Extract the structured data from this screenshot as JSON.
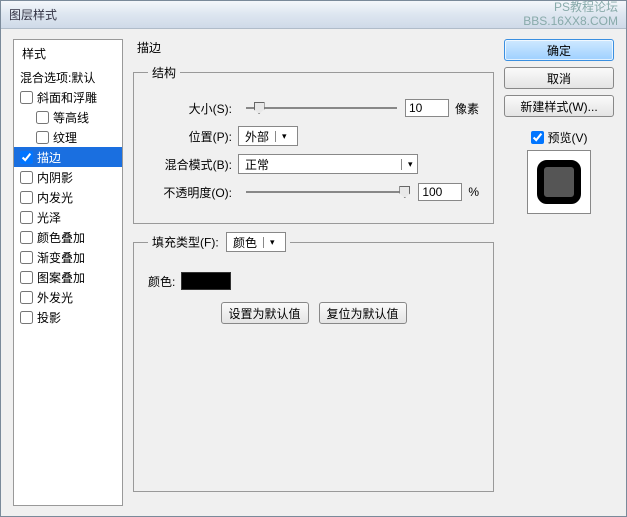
{
  "window": {
    "title": "图层样式"
  },
  "watermark": {
    "l1": "PS教程论坛",
    "l2": "BBS.16XX8.COM"
  },
  "sidebar": {
    "header": "样式",
    "blend": "混合选项:默认",
    "items": [
      {
        "label": "斜面和浮雕",
        "checked": false
      },
      {
        "label": "等高线",
        "checked": false,
        "indent": true
      },
      {
        "label": "纹理",
        "checked": false,
        "indent": true
      },
      {
        "label": "描边",
        "checked": true,
        "selected": true
      },
      {
        "label": "内阴影",
        "checked": false
      },
      {
        "label": "内发光",
        "checked": false
      },
      {
        "label": "光泽",
        "checked": false
      },
      {
        "label": "颜色叠加",
        "checked": false
      },
      {
        "label": "渐变叠加",
        "checked": false
      },
      {
        "label": "图案叠加",
        "checked": false
      },
      {
        "label": "外发光",
        "checked": false
      },
      {
        "label": "投影",
        "checked": false
      }
    ]
  },
  "main": {
    "section_title": "描边",
    "structure_legend": "结构",
    "size_label": "大小(S):",
    "size_value": "10",
    "size_unit": "像素",
    "position_label": "位置(P):",
    "position_value": "外部",
    "blend_label": "混合模式(B):",
    "blend_value": "正常",
    "opacity_label": "不透明度(O):",
    "opacity_value": "100",
    "opacity_unit": "%",
    "fill_legend": "填充类型(F):",
    "fill_type": "颜色",
    "color_label": "颜色:",
    "color_value": "#000000",
    "default_btn": "设置为默认值",
    "reset_btn": "复位为默认值"
  },
  "right": {
    "ok": "确定",
    "cancel": "取消",
    "new_style": "新建样式(W)...",
    "preview": "预览(V)"
  }
}
